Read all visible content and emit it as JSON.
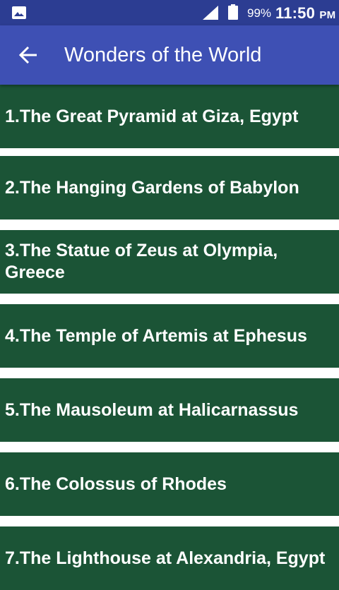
{
  "status_bar": {
    "battery": "99%",
    "time": "11:50",
    "ampm": "PM",
    "icons": [
      "image-icon",
      "signal-icon",
      "battery-icon"
    ]
  },
  "app_bar": {
    "title": "Wonders of the World",
    "back_icon": "arrow-back-icon"
  },
  "colors": {
    "status_bar": "#2c3d92",
    "app_bar": "#3e50b4",
    "item_background": "#1b5436",
    "item_text": "#ffffff"
  },
  "items": [
    {
      "label": "1.The Great Pyramid at Giza, Egypt"
    },
    {
      "label": "2.The Hanging Gardens of Babylon"
    },
    {
      "label": "3.The Statue of Zeus at Olympia, Greece"
    },
    {
      "label": "4.The Temple of Artemis at Ephesus"
    },
    {
      "label": "5.The Mausoleum at Halicarnassus"
    },
    {
      "label": "6.The Colossus of Rhodes"
    },
    {
      "label": "7.The Lighthouse at Alexandria, Egypt"
    }
  ]
}
